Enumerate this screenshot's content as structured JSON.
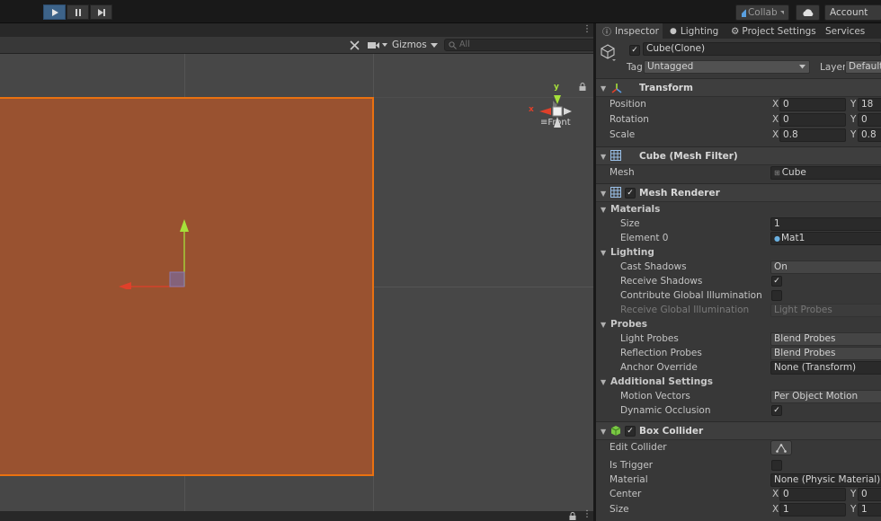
{
  "toolbar": {
    "collab_label": "Collab",
    "account_label": "Account"
  },
  "scene": {
    "gizmos_label": "Gizmos",
    "search_placeholder": "All",
    "orientation_label": "Front",
    "axis_x": "x",
    "axis_y": "y"
  },
  "inspector": {
    "tabs": [
      "Inspector",
      "Lighting",
      "Project Settings",
      "Services"
    ],
    "object_name": "Cube(Clone)",
    "object_active": true,
    "tag_label": "Tag",
    "tag_value": "Untagged",
    "layer_label": "Layer",
    "layer_value": "Default",
    "transform": {
      "title": "Transform",
      "position_label": "Position",
      "rotation_label": "Rotation",
      "scale_label": "Scale",
      "position": {
        "x": "0",
        "y": "18"
      },
      "rotation": {
        "x": "0",
        "y": "0"
      },
      "scale": {
        "x": "0.8",
        "y": "0.8"
      }
    },
    "mesh_filter": {
      "title": "Cube (Mesh Filter)",
      "mesh_label": "Mesh",
      "mesh_value": "Cube"
    },
    "mesh_renderer": {
      "title": "Mesh Renderer",
      "enabled": true,
      "materials_header": "Materials",
      "size_label": "Size",
      "size_value": "1",
      "element0_label": "Element 0",
      "element0_value": "Mat1",
      "lighting_header": "Lighting",
      "cast_shadows_label": "Cast Shadows",
      "cast_shadows_value": "On",
      "receive_shadows_label": "Receive Shadows",
      "receive_shadows": true,
      "contribute_gi_label": "Contribute Global Illumination",
      "contribute_gi": false,
      "receive_gi_label": "Receive Global Illumination",
      "receive_gi_value": "Light Probes",
      "probes_header": "Probes",
      "light_probes_label": "Light Probes",
      "light_probes_value": "Blend Probes",
      "reflection_probes_label": "Reflection Probes",
      "reflection_probes_value": "Blend Probes",
      "anchor_override_label": "Anchor Override",
      "anchor_override_value": "None (Transform)",
      "additional_header": "Additional Settings",
      "motion_vectors_label": "Motion Vectors",
      "motion_vectors_value": "Per Object Motion",
      "dynamic_occlusion_label": "Dynamic Occlusion",
      "dynamic_occlusion": true
    },
    "box_collider": {
      "title": "Box Collider",
      "enabled": true,
      "edit_collider_label": "Edit Collider",
      "is_trigger_label": "Is Trigger",
      "is_trigger": false,
      "material_label": "Material",
      "material_value": "None (Physic Material)",
      "center_label": "Center",
      "center": {
        "x": "0",
        "y": "0"
      },
      "size_label": "Size",
      "size": {
        "x": "1",
        "y": "1"
      }
    },
    "axis_x_label": "X",
    "axis_y_label": "Y",
    "check_glyph": "✓"
  },
  "colors": {
    "cube_fill": "#995230",
    "cube_outline": "#ea7110",
    "play_active": "#3d6389",
    "gizmo_x": "#e0402a",
    "gizmo_y": "#a6e03a"
  }
}
